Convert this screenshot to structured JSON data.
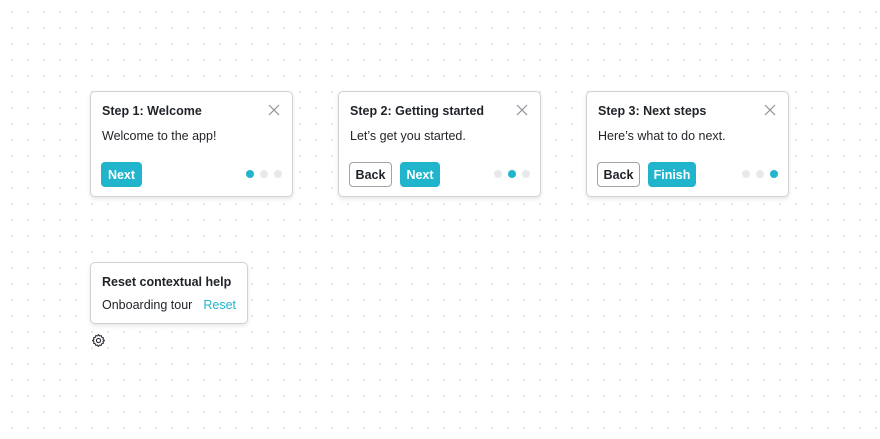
{
  "steps": [
    {
      "title": "Step 1: Welcome",
      "body": "Welcome to the app!",
      "back_label": null,
      "primary_label": "Next",
      "current_dot": 0
    },
    {
      "title": "Step 2: Getting started",
      "body": "Let’s get you started.",
      "back_label": "Back",
      "primary_label": "Next",
      "current_dot": 1
    },
    {
      "title": "Step 3: Next steps",
      "body": "Here’s what to do next.",
      "back_label": "Back",
      "primary_label": "Finish",
      "current_dot": 2
    }
  ],
  "reset_panel": {
    "title": "Reset contextual help",
    "item_label": "Onboarding tour",
    "reset_label": "Reset"
  },
  "icons": {
    "close": "close-icon",
    "settings": "gear-icon"
  },
  "colors": {
    "accent": "#21b5cd",
    "dot_inactive": "#e8e9eb",
    "border": "#cfd1d5"
  }
}
